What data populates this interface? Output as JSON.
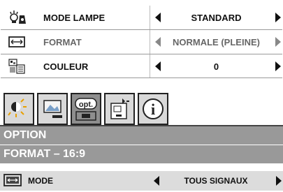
{
  "settings": {
    "rows": [
      {
        "icon": "lamp-icon",
        "label": "MODE LAMPE",
        "value": "STANDARD",
        "enabled": true
      },
      {
        "icon": "format-icon",
        "label": "FORMAT",
        "value": "NORMALE (PLEINE)",
        "enabled": false
      },
      {
        "icon": "color-icon",
        "label": "COULEUR",
        "value": "0",
        "enabled": true
      }
    ]
  },
  "tabs": {
    "items": [
      {
        "icon": "image-adjust-icon",
        "label": ""
      },
      {
        "icon": "picture-icon",
        "label": ""
      },
      {
        "icon": "option-icon",
        "label": "opt.",
        "active": true
      },
      {
        "icon": "setup-icon",
        "label": ""
      },
      {
        "icon": "info-icon",
        "label": "i"
      }
    ]
  },
  "option_panel": {
    "title": "OPTION",
    "subtitle": "FORMAT – 16:9",
    "mode_row": {
      "icon": "screen-mode-icon",
      "label": "MODE",
      "value": "TOUS SIGNAUX"
    }
  }
}
